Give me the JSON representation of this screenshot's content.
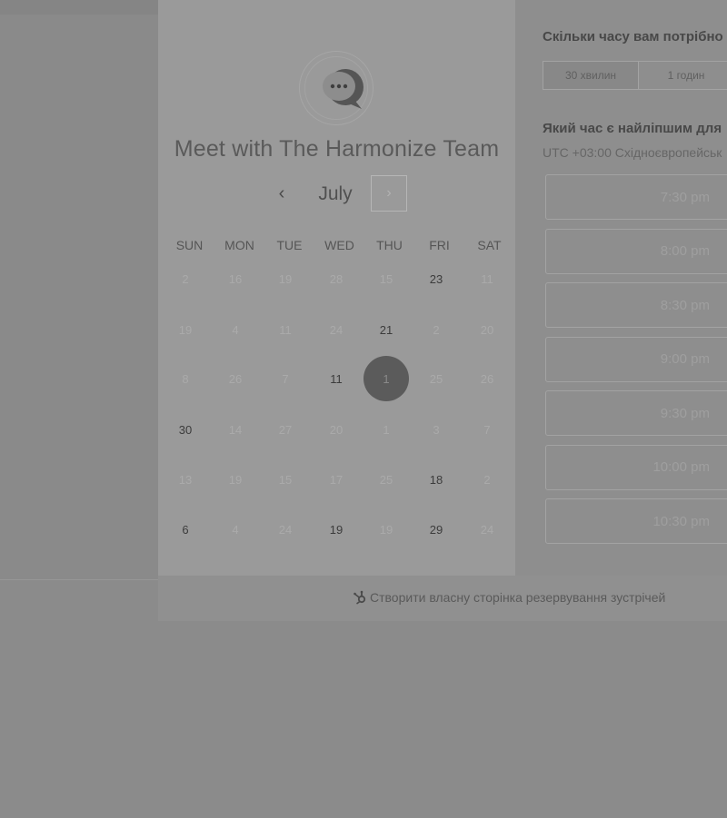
{
  "meeting": {
    "title": "Meet with The Harmonize Team",
    "avatar_icon": "chat-bubble-icon"
  },
  "calendar": {
    "month": "July",
    "prev_icon": "‹",
    "next_icon": "›",
    "days_of_week": [
      "SUN",
      "MON",
      "TUE",
      "WED",
      "THU",
      "FRI",
      "SAT"
    ],
    "weeks": [
      [
        {
          "d": "2",
          "s": "disabled"
        },
        {
          "d": "16",
          "s": "disabled"
        },
        {
          "d": "19",
          "s": "disabled"
        },
        {
          "d": "28",
          "s": "disabled"
        },
        {
          "d": "15",
          "s": "disabled"
        },
        {
          "d": "23",
          "s": "available"
        },
        {
          "d": "11",
          "s": "disabled"
        }
      ],
      [
        {
          "d": "19",
          "s": "disabled"
        },
        {
          "d": "4",
          "s": "disabled"
        },
        {
          "d": "11",
          "s": "disabled"
        },
        {
          "d": "24",
          "s": "disabled"
        },
        {
          "d": "21",
          "s": "available"
        },
        {
          "d": "2",
          "s": "disabled"
        },
        {
          "d": "20",
          "s": "disabled"
        }
      ],
      [
        {
          "d": "8",
          "s": "disabled"
        },
        {
          "d": "26",
          "s": "disabled"
        },
        {
          "d": "7",
          "s": "disabled"
        },
        {
          "d": "11",
          "s": "available"
        },
        {
          "d": "1",
          "s": "selected"
        },
        {
          "d": "25",
          "s": "disabled"
        },
        {
          "d": "26",
          "s": "disabled"
        }
      ],
      [
        {
          "d": "30",
          "s": "available"
        },
        {
          "d": "14",
          "s": "disabled"
        },
        {
          "d": "27",
          "s": "disabled"
        },
        {
          "d": "20",
          "s": "disabled"
        },
        {
          "d": "1",
          "s": "disabled"
        },
        {
          "d": "3",
          "s": "disabled"
        },
        {
          "d": "7",
          "s": "disabled"
        }
      ],
      [
        {
          "d": "13",
          "s": "disabled"
        },
        {
          "d": "19",
          "s": "disabled"
        },
        {
          "d": "15",
          "s": "disabled"
        },
        {
          "d": "17",
          "s": "disabled"
        },
        {
          "d": "25",
          "s": "disabled"
        },
        {
          "d": "18",
          "s": "available"
        },
        {
          "d": "2",
          "s": "disabled"
        }
      ],
      [
        {
          "d": "6",
          "s": "available"
        },
        {
          "d": "4",
          "s": "disabled"
        },
        {
          "d": "24",
          "s": "disabled"
        },
        {
          "d": "19",
          "s": "available"
        },
        {
          "d": "19",
          "s": "disabled"
        },
        {
          "d": "29",
          "s": "available"
        },
        {
          "d": "24",
          "s": "disabled"
        }
      ]
    ]
  },
  "booking": {
    "duration_heading": "Скільки часу вам потрібно",
    "durations": [
      {
        "label": "30 хвилин",
        "active": true
      },
      {
        "label": "1 годин",
        "active": false
      }
    ],
    "time_heading": "Який час є найліпшим для",
    "timezone": "UTC +03:00 Східноєвропейськ",
    "slots": [
      "7:30 pm",
      "8:00 pm",
      "8:30 pm",
      "9:00 pm",
      "9:30 pm",
      "10:00 pm",
      "10:30 pm"
    ]
  },
  "footer": {
    "link_text": "Створити власну сторінка резервування зустрічей",
    "icon": "hubspot-sprocket-icon"
  }
}
